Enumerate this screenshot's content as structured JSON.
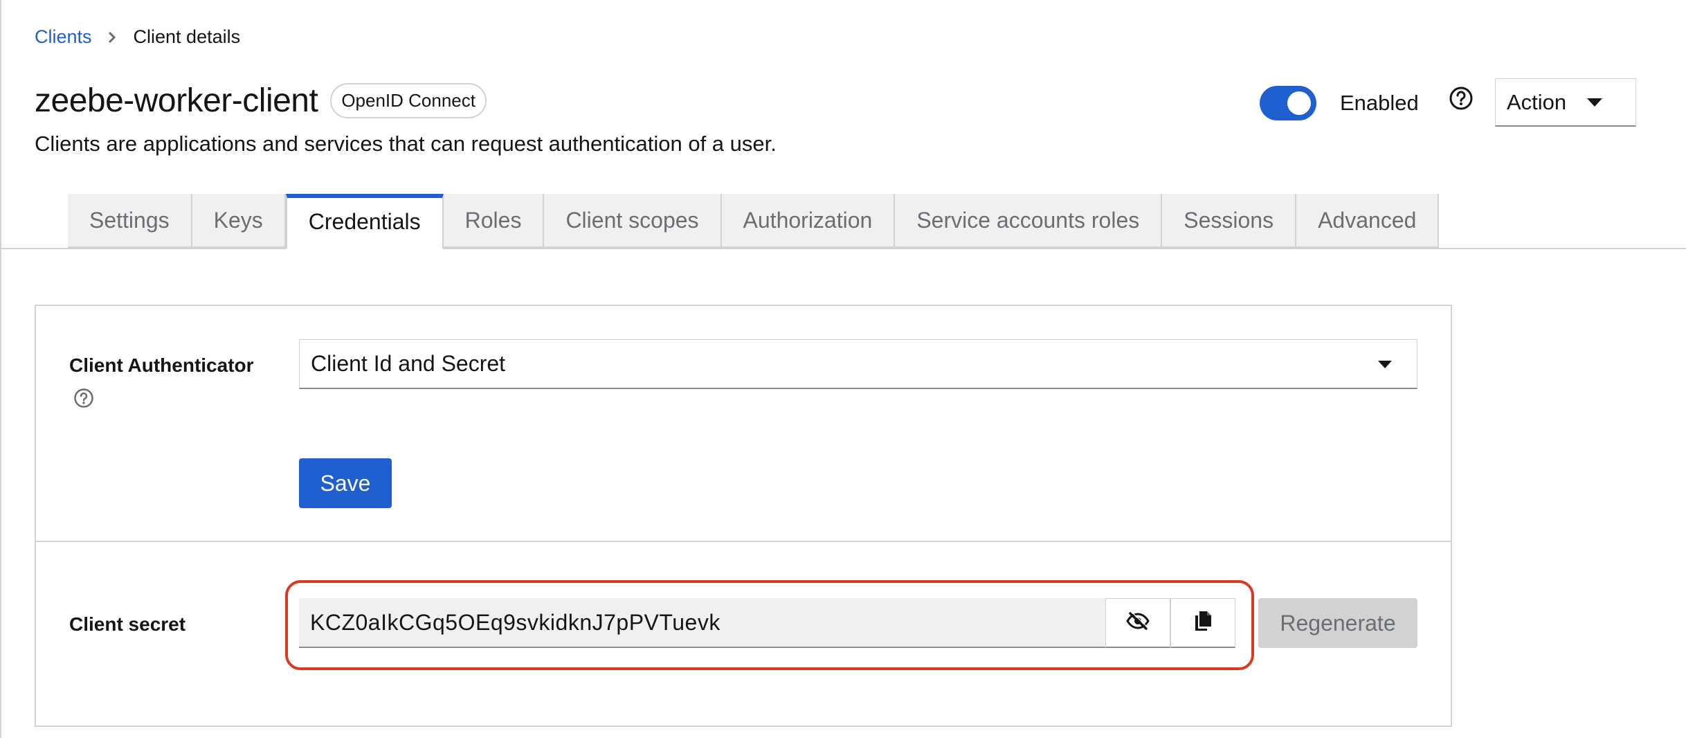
{
  "breadcrumb": {
    "parent": "Clients",
    "current": "Client details"
  },
  "header": {
    "title": "zeebe-worker-client",
    "protocol_badge": "OpenID Connect",
    "description": "Clients are applications and services that can request authentication of a user.",
    "enabled_label": "Enabled",
    "enabled": true,
    "action_label": "Action"
  },
  "tabs": [
    {
      "label": "Settings",
      "active": false
    },
    {
      "label": "Keys",
      "active": false
    },
    {
      "label": "Credentials",
      "active": true
    },
    {
      "label": "Roles",
      "active": false
    },
    {
      "label": "Client scopes",
      "active": false
    },
    {
      "label": "Authorization",
      "active": false
    },
    {
      "label": "Service accounts roles",
      "active": false
    },
    {
      "label": "Sessions",
      "active": false
    },
    {
      "label": "Advanced",
      "active": false
    }
  ],
  "credentials": {
    "authenticator_label": "Client Authenticator",
    "authenticator_value": "Client Id and Secret",
    "save_label": "Save",
    "secret_label": "Client secret",
    "secret_value": "KCZ0aIkCGq5OEq9svkidknJ7pPVTuevk",
    "regenerate_label": "Regenerate"
  },
  "colors": {
    "accent": "#1f5fcf",
    "highlight": "#d83a22",
    "disabled": "#d2d2d2"
  },
  "icons": [
    "chevron-right-icon",
    "help-icon",
    "caret-down-icon",
    "eye-slash-icon",
    "copy-icon"
  ]
}
